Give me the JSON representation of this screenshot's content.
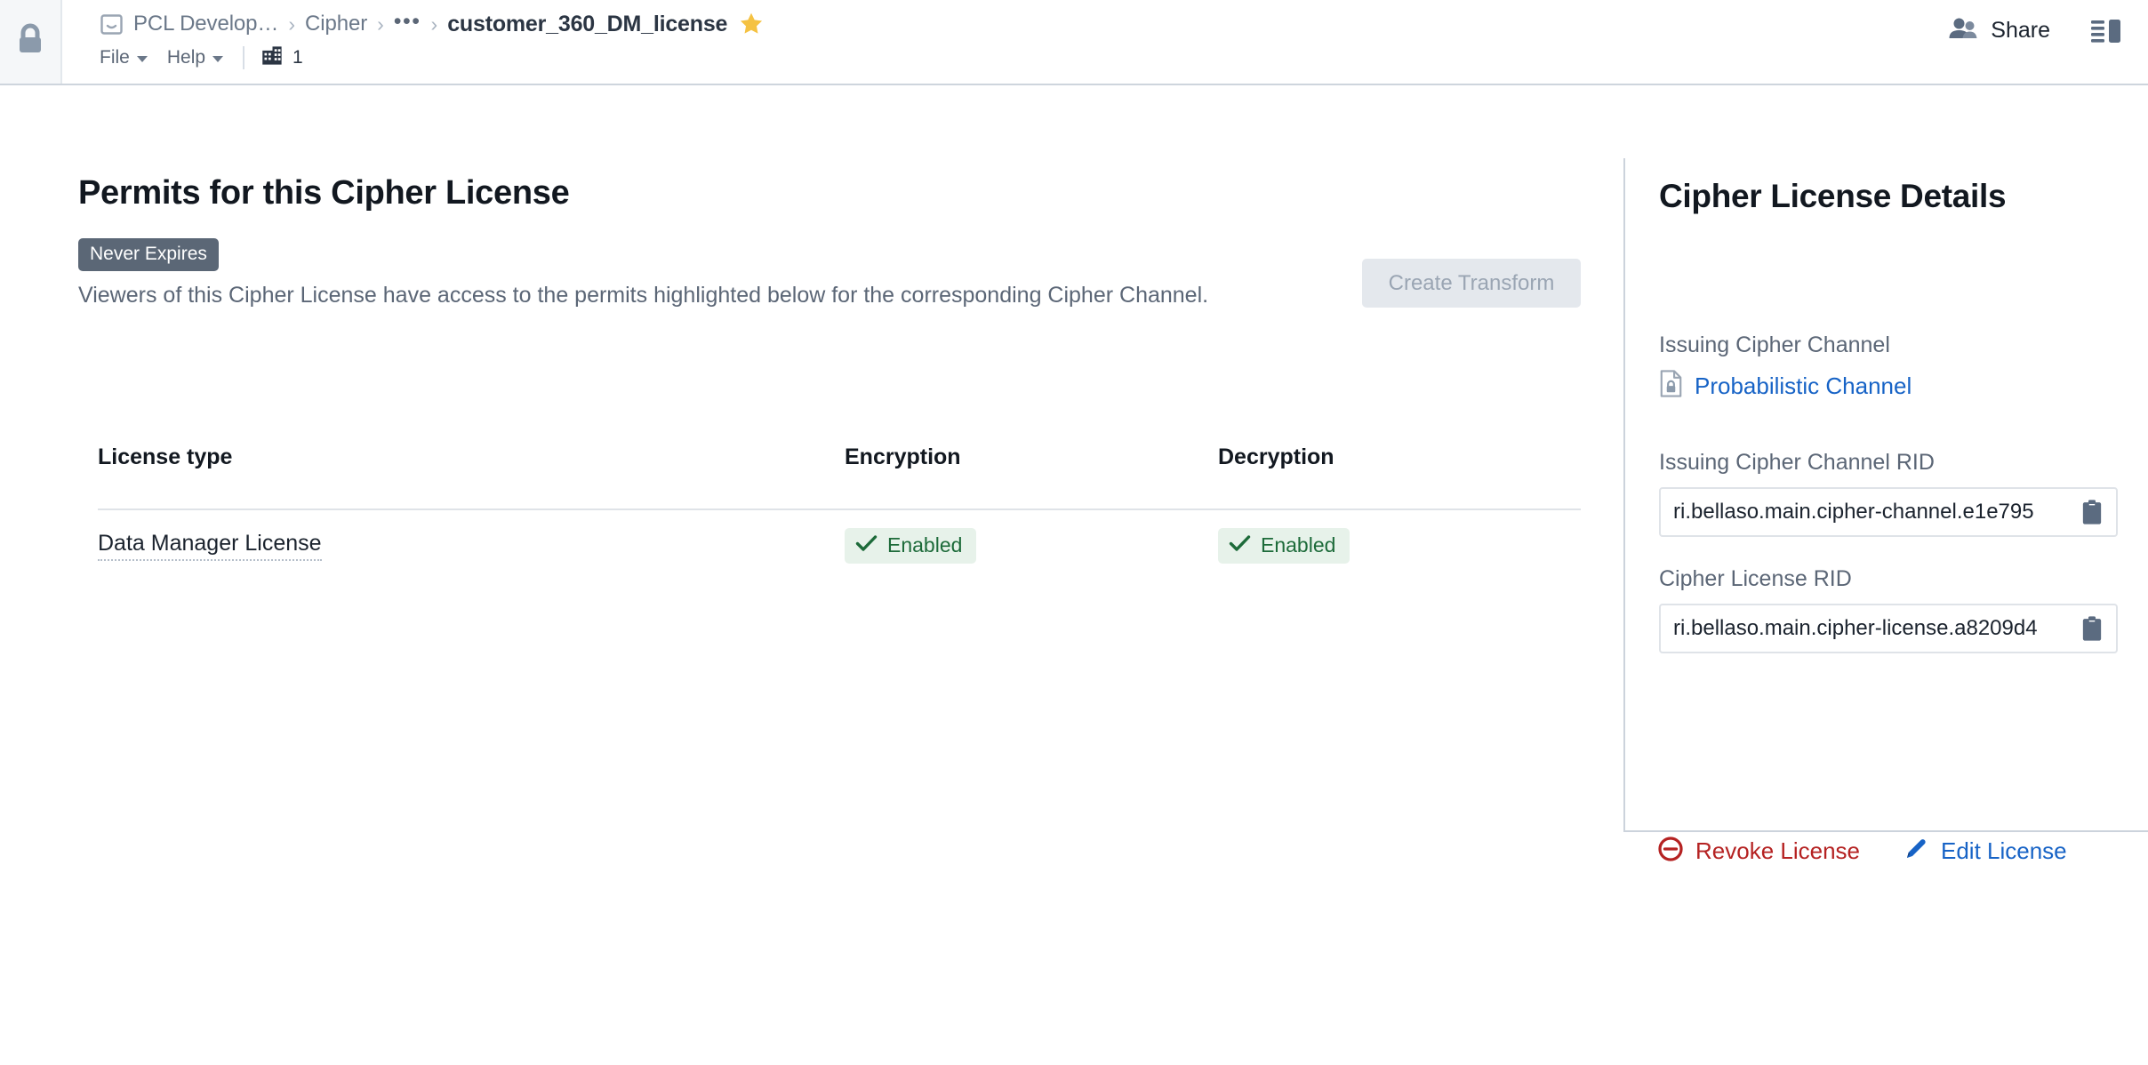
{
  "header": {
    "lock_icon": "lock-icon",
    "breadcrumb": {
      "doc_icon": "document-icon",
      "items": [
        "PCL Develop…",
        "Cipher"
      ],
      "separator": "›",
      "ellipsis": "•••",
      "current": "customer_360_DM_license",
      "star_icon": "star-favorite-icon"
    },
    "menu": {
      "file_label": "File",
      "help_label": "Help",
      "org_icon": "organization-building-icon",
      "org_count": "1"
    },
    "share_label": "Share",
    "share_icon": "people-share-icon",
    "panel_toggle_icon": "right-panel-toggle-icon"
  },
  "main": {
    "title": "Permits for this Cipher License",
    "expiry_badge": "Never Expires",
    "subtitle": "Viewers of this Cipher License have access to the permits highlighted below for the corresponding Cipher Channel.",
    "create_transform_label": "Create Transform",
    "table": {
      "columns": [
        "License type",
        "Encryption",
        "Decryption"
      ],
      "rows": [
        {
          "license_type": "Data Manager License",
          "encryption": {
            "label": "Enabled",
            "icon": "check-icon"
          },
          "decryption": {
            "label": "Enabled",
            "icon": "check-icon"
          }
        }
      ]
    }
  },
  "details": {
    "title": "Cipher License Details",
    "issuing_channel": {
      "label": "Issuing Cipher Channel",
      "icon": "document-lock-icon",
      "value": "Probabilistic Channel"
    },
    "issuing_channel_rid": {
      "label": "Issuing Cipher Channel RID",
      "value": "ri.bellaso.main.cipher-channel.e1e795",
      "copy_icon": "clipboard-copy-icon"
    },
    "license_rid": {
      "label": "Cipher License RID",
      "value": "ri.bellaso.main.cipher-license.a8209d4",
      "copy_icon": "clipboard-copy-icon"
    },
    "actions": {
      "revoke": {
        "label": "Revoke License",
        "icon": "minus-circle-icon"
      },
      "edit": {
        "label": "Edit License",
        "icon": "pencil-edit-icon"
      }
    }
  },
  "colors": {
    "accent_link": "#1763c6",
    "danger": "#b52222",
    "success": "#1d6b3a",
    "success_bg": "#e7f2ea",
    "badge_bg": "#5b6776",
    "star": "#f5c242",
    "muted_text": "#5b6676"
  }
}
